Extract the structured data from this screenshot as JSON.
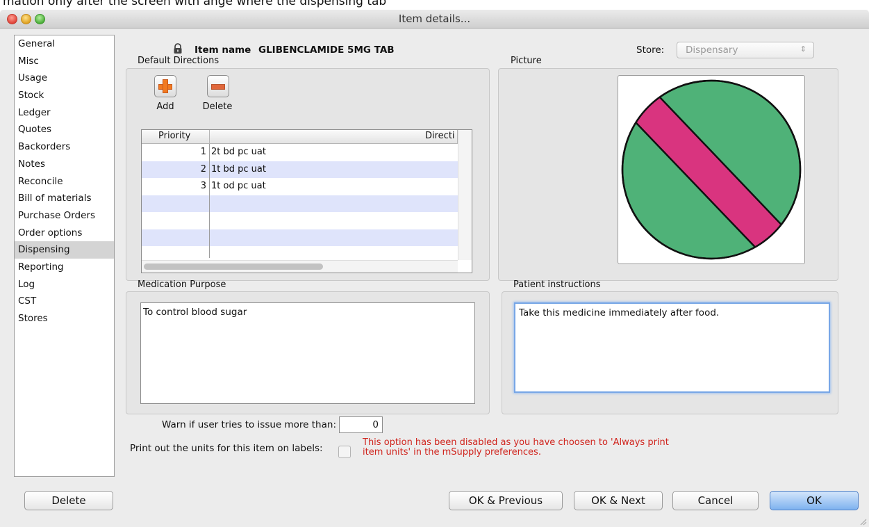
{
  "caption": "mation only after the screen with ange where the dispensing tab",
  "window": {
    "title": "Item details..."
  },
  "sidebar": {
    "items": [
      {
        "label": "General"
      },
      {
        "label": "Misc"
      },
      {
        "label": "Usage"
      },
      {
        "label": "Stock"
      },
      {
        "label": "Ledger"
      },
      {
        "label": "Quotes"
      },
      {
        "label": "Backorders"
      },
      {
        "label": "Notes"
      },
      {
        "label": "Reconcile"
      },
      {
        "label": "Bill of materials"
      },
      {
        "label": "Purchase Orders"
      },
      {
        "label": "Order options"
      },
      {
        "label": "Dispensing"
      },
      {
        "label": "Reporting"
      },
      {
        "label": "Log"
      },
      {
        "label": "CST"
      },
      {
        "label": "Stores"
      }
    ],
    "selected": "Dispensing"
  },
  "header": {
    "item_name_label": "Item name",
    "item_name_value": "GLIBENCLAMIDE 5MG TAB",
    "store_label": "Store:",
    "store_value": "Dispensary"
  },
  "directions": {
    "section_label": "Default Directions",
    "add_label": "Add",
    "delete_label": "Delete",
    "col_priority": "Priority",
    "col_direction": "Directi",
    "rows": [
      {
        "priority": "1",
        "direction": "2t bd pc uat"
      },
      {
        "priority": "2",
        "direction": "1t bd pc uat"
      },
      {
        "priority": "3",
        "direction": "1t od pc uat"
      }
    ]
  },
  "picture": {
    "label": "Picture",
    "icon": "tablet-picture"
  },
  "purpose": {
    "label": "Medication Purpose",
    "value": "To control blood sugar"
  },
  "patient": {
    "label": "Patient instructions",
    "value": "Take this medicine immediately after food."
  },
  "warn": {
    "label": "Warn if user tries to issue more than:",
    "value": "0"
  },
  "print_units": {
    "label": "Print out the units for this item on labels:",
    "note_line1": "This option has been disabled as you have choosen to 'Always print",
    "note_line2": "item units' in the mSupply preferences."
  },
  "footer": {
    "delete": "Delete",
    "ok_previous": "OK & Previous",
    "ok_next": "OK & Next",
    "cancel": "Cancel",
    "ok": "OK"
  },
  "colors": {
    "tablet_green": "#4fb278",
    "tablet_stripe": "#d9347f",
    "warning_text": "#d0241d",
    "selection": "#d4d4d4"
  }
}
